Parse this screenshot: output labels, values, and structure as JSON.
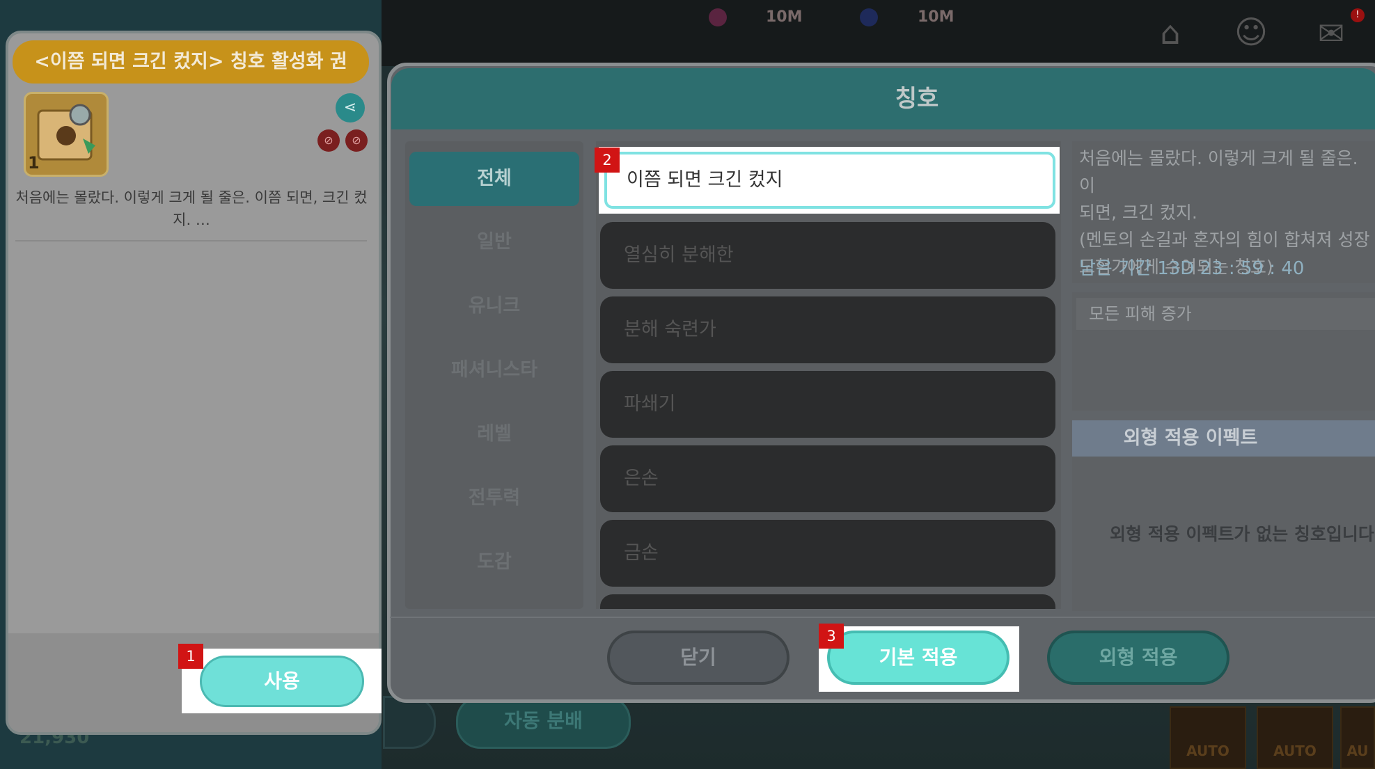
{
  "hud": {
    "currency1": "10M",
    "currency2": "10M",
    "mail_badge": "!"
  },
  "background": {
    "auto_dismantle_label": "자동 분배",
    "gold": "21,930",
    "auto_labels": [
      "AUTO",
      "AUTO",
      "AU"
    ]
  },
  "item_panel": {
    "title": "<이쯤 되면 크긴 컸지> 칭호 활성화 권",
    "icon_count": "1",
    "description": "처음에는 몰랐다. 이렇게 크게 될 줄은. 이쯤 되면, 크긴 컸지. …",
    "use_label": "사용"
  },
  "markers": {
    "m1": "1",
    "m2": "2",
    "m3": "3"
  },
  "dialog": {
    "title": "칭호",
    "categories": [
      "전체",
      "일반",
      "유니크",
      "패셔니스타",
      "레벨",
      "전투력",
      "도감"
    ],
    "titles": [
      "이쯤 되면 크긴 컸지",
      "열심히 분해한",
      "분해 숙련가",
      "파쇄기",
      "은손",
      "금손"
    ],
    "detail": {
      "description": "처음에는 몰랐다. 이렇게 크게 될 줄은. 이\n되면, 크긴 컸지.\n(멘토의 손길과 혼자의 힘이 합쳐져 성장\n모험가에게 수여되는 칭호)",
      "remaining": "남은 기간 13D 23 : 59 : 40",
      "stat": "모든 피해 증가",
      "effect_header": "외형 적용 이펙트",
      "effect_empty": "외형 적용 이펙트가 없는 칭호입니다"
    },
    "buttons": {
      "close": "닫기",
      "apply": "기본 적용",
      "look": "외형 적용"
    }
  }
}
